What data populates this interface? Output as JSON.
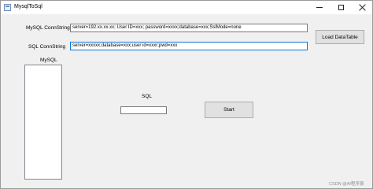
{
  "window": {
    "title": "MysqlToSql"
  },
  "controls": {
    "minimize": "minimize",
    "maximize": "maximize",
    "close": "close"
  },
  "mysql": {
    "label": "MySQL ConnString",
    "value": "server=192.xx.xx.xx; User ID=xxx; password=xxxx;database=xxx;SslMode=none"
  },
  "sql": {
    "label": "SQL ConnString",
    "value": "server=xxxxx;database=xxx;user id=xxxr;pwd=xxx"
  },
  "buttons": {
    "load": "Load DataTable",
    "start": "Start"
  },
  "list": {
    "label": "MySQL"
  },
  "sql_field": {
    "label": "SQL",
    "value": ""
  },
  "watermark": "CSDN @AI程序猿"
}
